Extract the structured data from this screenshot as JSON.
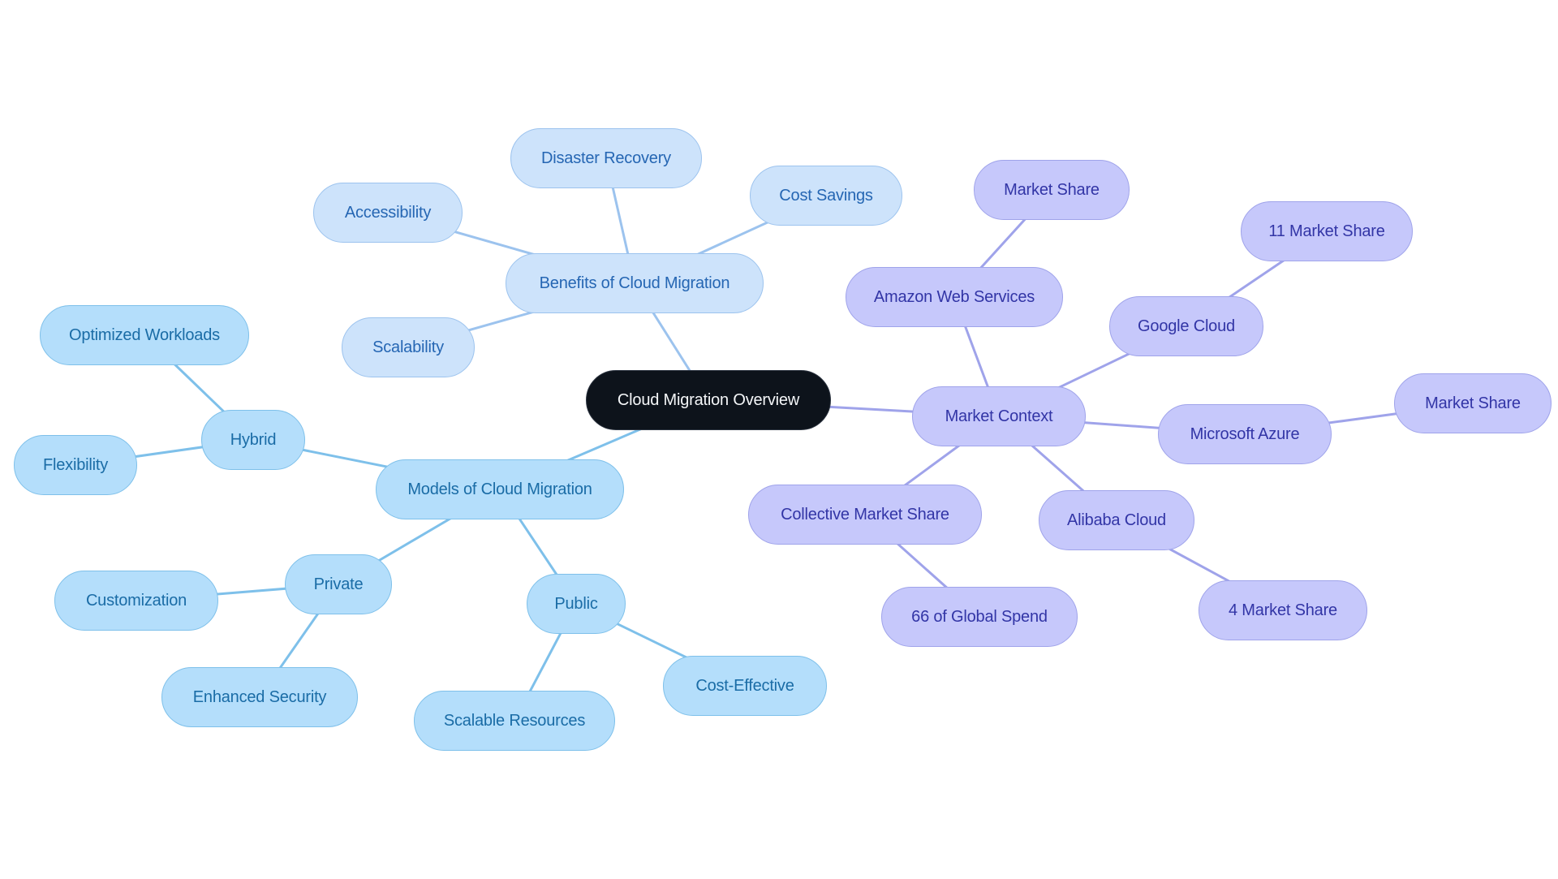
{
  "diagram": {
    "type": "mindmap",
    "title": "Cloud Migration Overview",
    "colors": {
      "root_fill": "#0d131b",
      "root_text": "#f4f6f8",
      "benefits_fill": "#cde3fb",
      "benefits_edge": "#9cc3ee",
      "benefits_text": "#2566b3",
      "models_fill": "#b4defb",
      "models_edge": "#7ec0ea",
      "models_text": "#1a6ca6",
      "market_fill": "#c6c8fb",
      "market_edge": "#9fa3ea",
      "market_text": "#3235a6"
    },
    "nodes": [
      {
        "id": "root",
        "label": "Cloud Migration Overview",
        "group": "root"
      },
      {
        "id": "benefits",
        "label": "Benefits of Cloud Migration",
        "group": "benefits"
      },
      {
        "id": "disaster",
        "label": "Disaster Recovery",
        "group": "benefits"
      },
      {
        "id": "cost-savings",
        "label": "Cost Savings",
        "group": "benefits"
      },
      {
        "id": "accessibility",
        "label": "Accessibility",
        "group": "benefits"
      },
      {
        "id": "scalability",
        "label": "Scalability",
        "group": "benefits"
      },
      {
        "id": "models",
        "label": "Models of Cloud Migration",
        "group": "models"
      },
      {
        "id": "hybrid",
        "label": "Hybrid",
        "group": "models"
      },
      {
        "id": "optimized",
        "label": "Optimized Workloads",
        "group": "models"
      },
      {
        "id": "flexibility",
        "label": "Flexibility",
        "group": "models"
      },
      {
        "id": "private",
        "label": "Private",
        "group": "models"
      },
      {
        "id": "customization",
        "label": "Customization",
        "group": "models"
      },
      {
        "id": "enhanced-security",
        "label": "Enhanced Security",
        "group": "models"
      },
      {
        "id": "public",
        "label": "Public",
        "group": "models"
      },
      {
        "id": "scalable-resources",
        "label": "Scalable Resources",
        "group": "models"
      },
      {
        "id": "cost-effective",
        "label": "Cost-Effective",
        "group": "models"
      },
      {
        "id": "market-context",
        "label": "Market Context",
        "group": "market"
      },
      {
        "id": "aws",
        "label": "Amazon Web Services",
        "group": "market"
      },
      {
        "id": "aws-share",
        "label": "Market Share",
        "group": "market"
      },
      {
        "id": "google",
        "label": "Google Cloud",
        "group": "market"
      },
      {
        "id": "google-share",
        "label": "11 Market Share",
        "group": "market"
      },
      {
        "id": "azure",
        "label": "Microsoft Azure",
        "group": "market"
      },
      {
        "id": "azure-share",
        "label": "Market Share",
        "group": "market"
      },
      {
        "id": "alibaba",
        "label": "Alibaba Cloud",
        "group": "market"
      },
      {
        "id": "alibaba-share",
        "label": "4 Market Share",
        "group": "market"
      },
      {
        "id": "collective",
        "label": "Collective Market Share",
        "group": "market"
      },
      {
        "id": "global-spend",
        "label": "66 of Global Spend",
        "group": "market"
      }
    ],
    "edges": [
      {
        "from": "root",
        "to": "benefits",
        "group": "benefits"
      },
      {
        "from": "benefits",
        "to": "disaster",
        "group": "benefits"
      },
      {
        "from": "benefits",
        "to": "cost-savings",
        "group": "benefits"
      },
      {
        "from": "benefits",
        "to": "accessibility",
        "group": "benefits"
      },
      {
        "from": "benefits",
        "to": "scalability",
        "group": "benefits"
      },
      {
        "from": "root",
        "to": "models",
        "group": "models"
      },
      {
        "from": "models",
        "to": "hybrid",
        "group": "models"
      },
      {
        "from": "hybrid",
        "to": "optimized",
        "group": "models"
      },
      {
        "from": "hybrid",
        "to": "flexibility",
        "group": "models"
      },
      {
        "from": "models",
        "to": "private",
        "group": "models"
      },
      {
        "from": "private",
        "to": "customization",
        "group": "models"
      },
      {
        "from": "private",
        "to": "enhanced-security",
        "group": "models"
      },
      {
        "from": "models",
        "to": "public",
        "group": "models"
      },
      {
        "from": "public",
        "to": "scalable-resources",
        "group": "models"
      },
      {
        "from": "public",
        "to": "cost-effective",
        "group": "models"
      },
      {
        "from": "root",
        "to": "market-context",
        "group": "market"
      },
      {
        "from": "market-context",
        "to": "aws",
        "group": "market"
      },
      {
        "from": "aws",
        "to": "aws-share",
        "group": "market"
      },
      {
        "from": "market-context",
        "to": "google",
        "group": "market"
      },
      {
        "from": "google",
        "to": "google-share",
        "group": "market"
      },
      {
        "from": "market-context",
        "to": "azure",
        "group": "market"
      },
      {
        "from": "azure",
        "to": "azure-share",
        "group": "market"
      },
      {
        "from": "market-context",
        "to": "alibaba",
        "group": "market"
      },
      {
        "from": "alibaba",
        "to": "alibaba-share",
        "group": "market"
      },
      {
        "from": "market-context",
        "to": "collective",
        "group": "market"
      },
      {
        "from": "collective",
        "to": "global-spend",
        "group": "market"
      }
    ]
  }
}
